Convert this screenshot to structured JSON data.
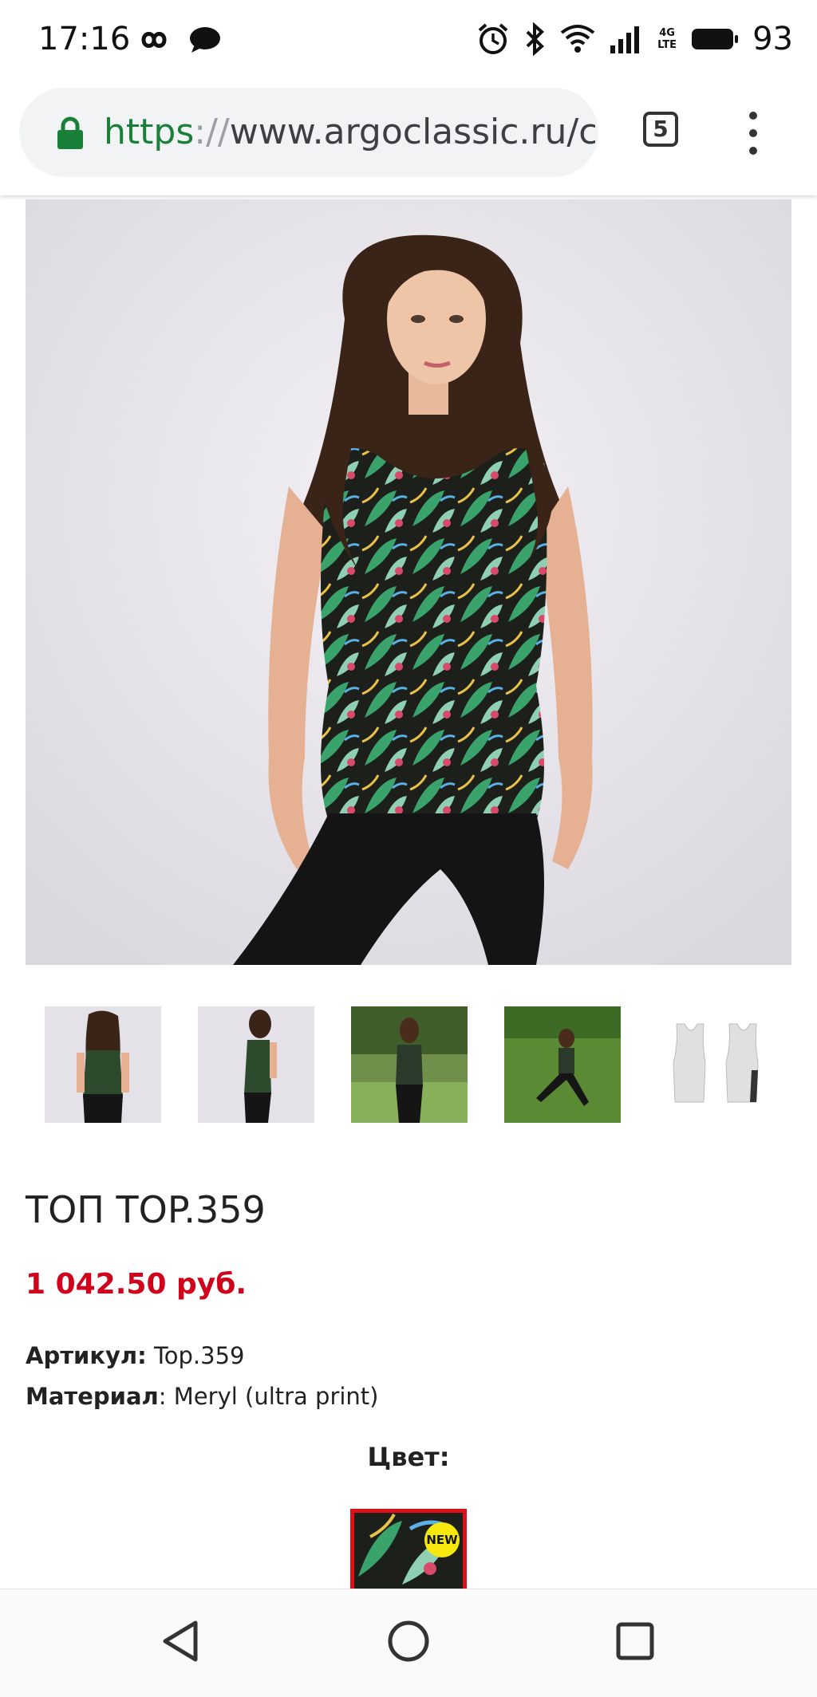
{
  "status_bar": {
    "time": "17:16",
    "network_label": "4G LTE",
    "battery_percent": "93",
    "icons": [
      "infinity-icon",
      "chat-bubble-icon",
      "alarm-icon",
      "bluetooth-icon",
      "wifi-icon",
      "signal-icon",
      "battery-icon"
    ]
  },
  "browser": {
    "url_scheme": "https",
    "url_separator": "://",
    "url_rest": "www.argoclassic.ru/c",
    "tab_count": "5"
  },
  "product": {
    "title": "ТОП TOP.359",
    "price": "1 042.50 руб.",
    "sku_label": "Артикул:",
    "sku_value": " Top.359",
    "material_label": "Материал",
    "material_value": ": Meryl (ultra print)",
    "color_label": "Цвет:",
    "new_badge": "NEW"
  },
  "thumbnails": [
    {
      "name": "back-view"
    },
    {
      "name": "side-view"
    },
    {
      "name": "park-view"
    },
    {
      "name": "grass-view"
    },
    {
      "name": "flat-sketch"
    }
  ],
  "colors": {
    "price": "#d0021b",
    "url_green": "#188038",
    "swatch_border": "#e0101a",
    "badge": "#f6e80c"
  }
}
